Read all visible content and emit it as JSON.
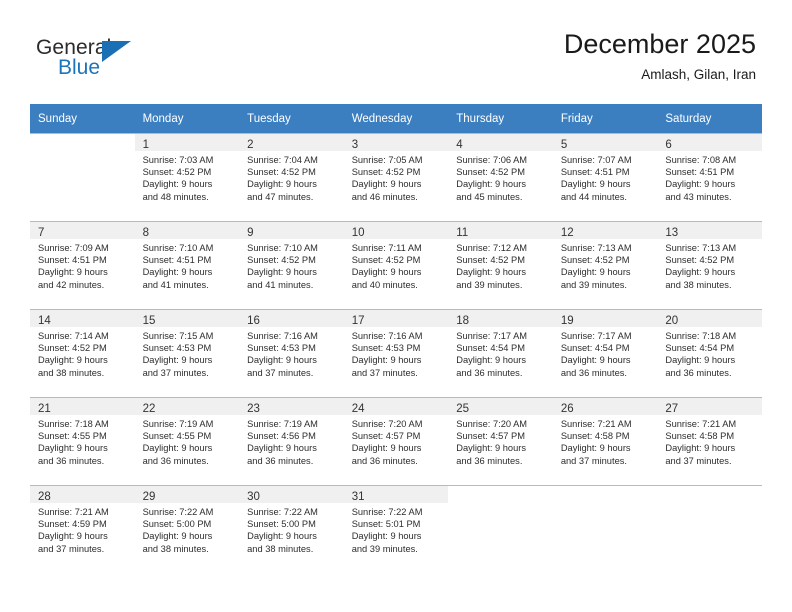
{
  "brand": {
    "name_top": "General",
    "name_bottom": "Blue",
    "triangle_color": "#1a6fb5",
    "blue_color": "#1d74bb"
  },
  "header": {
    "title": "December 2025",
    "subtitle": "Amlash, Gilan, Iran"
  },
  "theme": {
    "header_row_bg": "#3c7fc1",
    "header_row_text": "#ffffff",
    "daynum_bg": "#f0f0f0",
    "grid_line": "#b9b9b9"
  },
  "weekdays": [
    "Sunday",
    "Monday",
    "Tuesday",
    "Wednesday",
    "Thursday",
    "Friday",
    "Saturday"
  ],
  "weeks": [
    [
      {
        "day": "",
        "sunrise": "",
        "sunset": "",
        "daylight1": "",
        "daylight2": ""
      },
      {
        "day": "1",
        "sunrise": "Sunrise: 7:03 AM",
        "sunset": "Sunset: 4:52 PM",
        "daylight1": "Daylight: 9 hours",
        "daylight2": "and 48 minutes."
      },
      {
        "day": "2",
        "sunrise": "Sunrise: 7:04 AM",
        "sunset": "Sunset: 4:52 PM",
        "daylight1": "Daylight: 9 hours",
        "daylight2": "and 47 minutes."
      },
      {
        "day": "3",
        "sunrise": "Sunrise: 7:05 AM",
        "sunset": "Sunset: 4:52 PM",
        "daylight1": "Daylight: 9 hours",
        "daylight2": "and 46 minutes."
      },
      {
        "day": "4",
        "sunrise": "Sunrise: 7:06 AM",
        "sunset": "Sunset: 4:52 PM",
        "daylight1": "Daylight: 9 hours",
        "daylight2": "and 45 minutes."
      },
      {
        "day": "5",
        "sunrise": "Sunrise: 7:07 AM",
        "sunset": "Sunset: 4:51 PM",
        "daylight1": "Daylight: 9 hours",
        "daylight2": "and 44 minutes."
      },
      {
        "day": "6",
        "sunrise": "Sunrise: 7:08 AM",
        "sunset": "Sunset: 4:51 PM",
        "daylight1": "Daylight: 9 hours",
        "daylight2": "and 43 minutes."
      }
    ],
    [
      {
        "day": "7",
        "sunrise": "Sunrise: 7:09 AM",
        "sunset": "Sunset: 4:51 PM",
        "daylight1": "Daylight: 9 hours",
        "daylight2": "and 42 minutes."
      },
      {
        "day": "8",
        "sunrise": "Sunrise: 7:10 AM",
        "sunset": "Sunset: 4:51 PM",
        "daylight1": "Daylight: 9 hours",
        "daylight2": "and 41 minutes."
      },
      {
        "day": "9",
        "sunrise": "Sunrise: 7:10 AM",
        "sunset": "Sunset: 4:52 PM",
        "daylight1": "Daylight: 9 hours",
        "daylight2": "and 41 minutes."
      },
      {
        "day": "10",
        "sunrise": "Sunrise: 7:11 AM",
        "sunset": "Sunset: 4:52 PM",
        "daylight1": "Daylight: 9 hours",
        "daylight2": "and 40 minutes."
      },
      {
        "day": "11",
        "sunrise": "Sunrise: 7:12 AM",
        "sunset": "Sunset: 4:52 PM",
        "daylight1": "Daylight: 9 hours",
        "daylight2": "and 39 minutes."
      },
      {
        "day": "12",
        "sunrise": "Sunrise: 7:13 AM",
        "sunset": "Sunset: 4:52 PM",
        "daylight1": "Daylight: 9 hours",
        "daylight2": "and 39 minutes."
      },
      {
        "day": "13",
        "sunrise": "Sunrise: 7:13 AM",
        "sunset": "Sunset: 4:52 PM",
        "daylight1": "Daylight: 9 hours",
        "daylight2": "and 38 minutes."
      }
    ],
    [
      {
        "day": "14",
        "sunrise": "Sunrise: 7:14 AM",
        "sunset": "Sunset: 4:52 PM",
        "daylight1": "Daylight: 9 hours",
        "daylight2": "and 38 minutes."
      },
      {
        "day": "15",
        "sunrise": "Sunrise: 7:15 AM",
        "sunset": "Sunset: 4:53 PM",
        "daylight1": "Daylight: 9 hours",
        "daylight2": "and 37 minutes."
      },
      {
        "day": "16",
        "sunrise": "Sunrise: 7:16 AM",
        "sunset": "Sunset: 4:53 PM",
        "daylight1": "Daylight: 9 hours",
        "daylight2": "and 37 minutes."
      },
      {
        "day": "17",
        "sunrise": "Sunrise: 7:16 AM",
        "sunset": "Sunset: 4:53 PM",
        "daylight1": "Daylight: 9 hours",
        "daylight2": "and 37 minutes."
      },
      {
        "day": "18",
        "sunrise": "Sunrise: 7:17 AM",
        "sunset": "Sunset: 4:54 PM",
        "daylight1": "Daylight: 9 hours",
        "daylight2": "and 36 minutes."
      },
      {
        "day": "19",
        "sunrise": "Sunrise: 7:17 AM",
        "sunset": "Sunset: 4:54 PM",
        "daylight1": "Daylight: 9 hours",
        "daylight2": "and 36 minutes."
      },
      {
        "day": "20",
        "sunrise": "Sunrise: 7:18 AM",
        "sunset": "Sunset: 4:54 PM",
        "daylight1": "Daylight: 9 hours",
        "daylight2": "and 36 minutes."
      }
    ],
    [
      {
        "day": "21",
        "sunrise": "Sunrise: 7:18 AM",
        "sunset": "Sunset: 4:55 PM",
        "daylight1": "Daylight: 9 hours",
        "daylight2": "and 36 minutes."
      },
      {
        "day": "22",
        "sunrise": "Sunrise: 7:19 AM",
        "sunset": "Sunset: 4:55 PM",
        "daylight1": "Daylight: 9 hours",
        "daylight2": "and 36 minutes."
      },
      {
        "day": "23",
        "sunrise": "Sunrise: 7:19 AM",
        "sunset": "Sunset: 4:56 PM",
        "daylight1": "Daylight: 9 hours",
        "daylight2": "and 36 minutes."
      },
      {
        "day": "24",
        "sunrise": "Sunrise: 7:20 AM",
        "sunset": "Sunset: 4:57 PM",
        "daylight1": "Daylight: 9 hours",
        "daylight2": "and 36 minutes."
      },
      {
        "day": "25",
        "sunrise": "Sunrise: 7:20 AM",
        "sunset": "Sunset: 4:57 PM",
        "daylight1": "Daylight: 9 hours",
        "daylight2": "and 36 minutes."
      },
      {
        "day": "26",
        "sunrise": "Sunrise: 7:21 AM",
        "sunset": "Sunset: 4:58 PM",
        "daylight1": "Daylight: 9 hours",
        "daylight2": "and 37 minutes."
      },
      {
        "day": "27",
        "sunrise": "Sunrise: 7:21 AM",
        "sunset": "Sunset: 4:58 PM",
        "daylight1": "Daylight: 9 hours",
        "daylight2": "and 37 minutes."
      }
    ],
    [
      {
        "day": "28",
        "sunrise": "Sunrise: 7:21 AM",
        "sunset": "Sunset: 4:59 PM",
        "daylight1": "Daylight: 9 hours",
        "daylight2": "and 37 minutes."
      },
      {
        "day": "29",
        "sunrise": "Sunrise: 7:22 AM",
        "sunset": "Sunset: 5:00 PM",
        "daylight1": "Daylight: 9 hours",
        "daylight2": "and 38 minutes."
      },
      {
        "day": "30",
        "sunrise": "Sunrise: 7:22 AM",
        "sunset": "Sunset: 5:00 PM",
        "daylight1": "Daylight: 9 hours",
        "daylight2": "and 38 minutes."
      },
      {
        "day": "31",
        "sunrise": "Sunrise: 7:22 AM",
        "sunset": "Sunset: 5:01 PM",
        "daylight1": "Daylight: 9 hours",
        "daylight2": "and 39 minutes."
      },
      {
        "day": "",
        "sunrise": "",
        "sunset": "",
        "daylight1": "",
        "daylight2": ""
      },
      {
        "day": "",
        "sunrise": "",
        "sunset": "",
        "daylight1": "",
        "daylight2": ""
      },
      {
        "day": "",
        "sunrise": "",
        "sunset": "",
        "daylight1": "",
        "daylight2": ""
      }
    ]
  ]
}
